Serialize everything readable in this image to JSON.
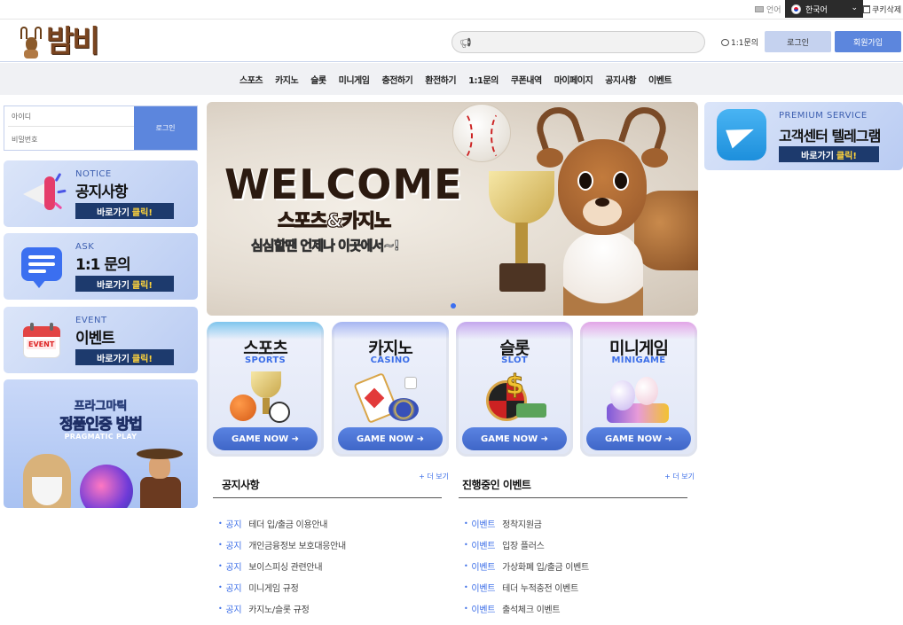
{
  "topbar": {
    "language_label": "언어",
    "language_selected": "한국어",
    "cookie_delete": "쿠키삭제"
  },
  "header": {
    "logo_text": "밤비",
    "search_placeholder": "",
    "inquiry_link": "1:1문의",
    "login_button": "로그인",
    "join_button": "회원가입"
  },
  "nav": {
    "items": [
      "스포츠",
      "카지노",
      "슬롯",
      "미니게임",
      "충전하기",
      "환전하기",
      "1:1문의",
      "쿠폰내역",
      "마이페이지",
      "공지사항",
      "이벤트"
    ]
  },
  "login_box": {
    "id_placeholder": "아이디",
    "pw_placeholder": "비밀번호",
    "submit": "로그인"
  },
  "promos": [
    {
      "tag": "NOTICE",
      "title": "공지사항",
      "go": "바로가기",
      "go_hl": "클릭!"
    },
    {
      "tag": "ASK",
      "title": "1:1 문의",
      "go": "바로가기",
      "go_hl": "클릭!"
    },
    {
      "tag": "EVENT",
      "title": "이벤트",
      "go": "바로가기",
      "go_hl": "클릭!"
    }
  ],
  "event_calendar_label": "EVENT",
  "pragmatic": {
    "line1": "프라그마틱",
    "line2": "정품인증 방법",
    "line3": "PRAGMATIC PLAY"
  },
  "hero": {
    "welcome": "WELCOME",
    "sub1": "스포츠&카지노",
    "sub2": "심심할땐 언제나 이곳에서~!"
  },
  "games": [
    {
      "name": "스포츠",
      "eng": "SPORTS",
      "button": "GAME NOW ➜",
      "stripe": "#7fc6ee"
    },
    {
      "name": "카지노",
      "eng": "CASINO",
      "button": "GAME NOW ➜",
      "stripe": "#a7b6f2"
    },
    {
      "name": "슬롯",
      "eng": "SLOT",
      "button": "GAME NOW ➜",
      "stripe": "#c5a8ee"
    },
    {
      "name": "미니게임",
      "eng": "MINIGAME",
      "button": "GAME NOW ➜",
      "stripe": "#e3a6e8"
    }
  ],
  "notice": {
    "title": "공지사항",
    "more": "+ 더 보기",
    "items": [
      {
        "cat": "공지",
        "text": "테더 입/출금 이용안내"
      },
      {
        "cat": "공지",
        "text": "개인금융정보 보호대응안내"
      },
      {
        "cat": "공지",
        "text": "보이스피싱 관련안내"
      },
      {
        "cat": "공지",
        "text": "미니게임 규정"
      },
      {
        "cat": "공지",
        "text": "카지노/슬롯 규정"
      }
    ]
  },
  "events": {
    "title": "진행중인 이벤트",
    "more": "+ 더 보기",
    "items": [
      {
        "cat": "이벤트",
        "text": "정착지원금"
      },
      {
        "cat": "이벤트",
        "text": "입장 플러스"
      },
      {
        "cat": "이벤트",
        "text": "가상화폐 입/출금 이벤트"
      },
      {
        "cat": "이벤트",
        "text": "테더 누적충전 이벤트"
      },
      {
        "cat": "이벤트",
        "text": "출석체크 이벤트"
      }
    ]
  },
  "telegram": {
    "tag": "PREMIUM SERVICE",
    "title": "고객센터 텔레그램",
    "go": "바로가기",
    "go_hl": "클릭!"
  }
}
